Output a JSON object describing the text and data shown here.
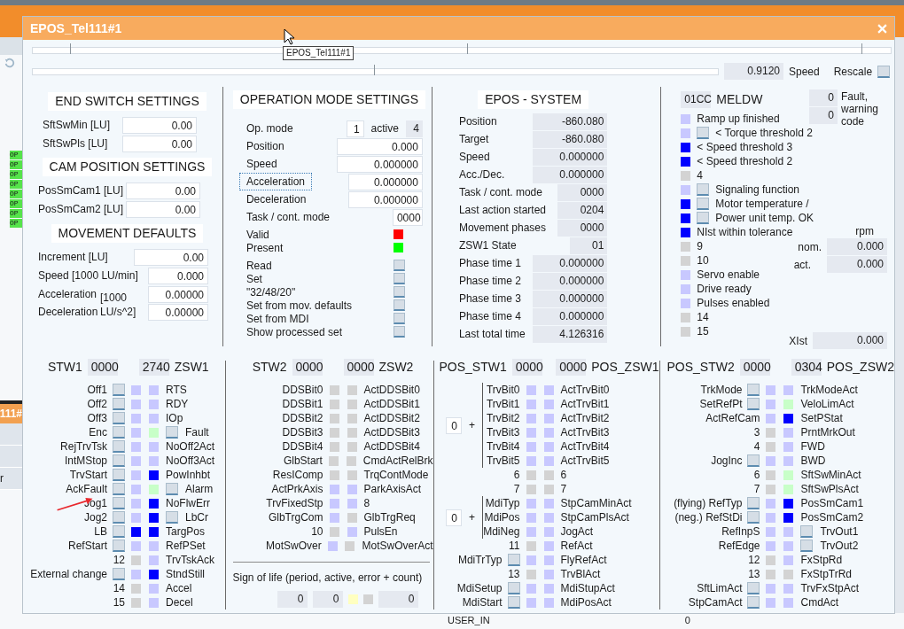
{
  "backdrop": {
    "tags": [
      "OP",
      "OP",
      "OP",
      "OP",
      "OP",
      "OP",
      "OP",
      "OP"
    ],
    "tab_fragment": "111#",
    "row_fragment": "r",
    "bottom_label": "USER_IN",
    "bottom_value": "0"
  },
  "window": {
    "title": "EPOS_Tel111#1",
    "tooltip": "EPOS_Tel111#1"
  },
  "speed": {
    "value": "0.9120",
    "label": "Speed",
    "rescale_label": "Rescale",
    "rescale_checked": false
  },
  "end_switch": {
    "title": "END SWITCH SETTINGS",
    "fields": [
      {
        "label": "SftSwMin [LU]",
        "value": "0.00"
      },
      {
        "label": "SftSwPls [LU]",
        "value": "0.00"
      }
    ]
  },
  "cam_position": {
    "title": "CAM POSITION SETTINGS",
    "fields": [
      {
        "label": "PosSmCam1 [LU]",
        "value": "0.00"
      },
      {
        "label": "PosSmCam2 [LU]",
        "value": "0.00"
      }
    ]
  },
  "movement": {
    "title": "MOVEMENT DEFAULTS",
    "fields": [
      {
        "label": "Increment [LU]",
        "value": "0.00"
      },
      {
        "label": "Speed [1000 LU/min]",
        "value": "0.000"
      }
    ],
    "accel_label": "Acceleration",
    "decel_label": "Deceleration",
    "unit": "[1000 LU/s^2]",
    "accel_value": "0.00000",
    "decel_value": "0.00000"
  },
  "op_mode": {
    "title": "OPERATION MODE SETTINGS",
    "mode_label": "Op. mode",
    "mode_value": "1",
    "active_label": "active",
    "active_value": "4",
    "fields": [
      {
        "label": "Position",
        "value": "0.000",
        "focused": false
      },
      {
        "label": "Speed",
        "value": "0.000000",
        "focused": false
      },
      {
        "label": "Acceleration",
        "value": "0.000000",
        "focused": true
      },
      {
        "label": "Deceleration",
        "value": "0.000000",
        "focused": false
      },
      {
        "label": "Task / cont. mode",
        "value": "0000",
        "focused": false
      }
    ],
    "indicators": [
      {
        "label": "Valid",
        "color": "#ff0000"
      },
      {
        "label": "Present",
        "color": "#00ff00"
      }
    ],
    "actions": [
      {
        "label": "Read",
        "checked": false
      },
      {
        "label": "Set",
        "checked": false
      },
      {
        "label": "\"32/48/20\"",
        "checked": false
      },
      {
        "label": "Set from mov. defaults",
        "checked": false
      },
      {
        "label": "Set from MDI",
        "checked": false
      },
      {
        "label": "Show processed set",
        "checked": false
      }
    ]
  },
  "epos_system": {
    "title": "EPOS - SYSTEM",
    "fields": [
      {
        "label": "Position",
        "value": "-860.080"
      },
      {
        "label": "Target",
        "value": "-860.080"
      },
      {
        "label": "Speed",
        "value": "0.000000"
      },
      {
        "label": "Acc./Dec.",
        "value": "0.000000"
      },
      {
        "label": "Task / cont. mode",
        "value": "0000"
      },
      {
        "label": "Last action started",
        "value": "0204"
      },
      {
        "label": "Movement phases",
        "value": "0000"
      },
      {
        "label": "ZSW1 State",
        "value": "01"
      },
      {
        "label": "Phase time 1",
        "value": "0.000000"
      },
      {
        "label": "Phase time 2",
        "value": "0.000000"
      },
      {
        "label": "Phase time 3",
        "value": "0.000000"
      },
      {
        "label": "Phase time 4",
        "value": "0.000000"
      },
      {
        "label": "Last total time",
        "value": "4.126316"
      }
    ]
  },
  "meldw": {
    "code": "01CC",
    "title": "MELDW",
    "fault_values": [
      "0",
      "0"
    ],
    "fault_label": "Fault, warning code",
    "rpm_label": "rpm",
    "nom_label": "nom.",
    "nom_value": "0.000",
    "act_label": "act.",
    "act_value": "0.000",
    "xist_label": "XIst",
    "xist_value": "0.000",
    "bits": [
      {
        "label": "Ramp up finished",
        "color": "#c8c8ff"
      },
      {
        "label": "< Torque threshold 2",
        "color": "#c8c8ff",
        "checked": false
      },
      {
        "label": "< Speed threshold 3",
        "color": "#0000ff"
      },
      {
        "label": "< Speed threshold 2",
        "color": "#0000ff"
      },
      {
        "label": "4",
        "color": "#d3d3d3"
      },
      {
        "label": "Signaling function",
        "color": "#c8c8ff",
        "checked": false
      },
      {
        "label": "Motor temperature /",
        "color": "#0000ff",
        "checked": false
      },
      {
        "label": "Power unit temp. OK",
        "color": "#0000ff",
        "checked": false
      },
      {
        "label": "NIst within tolerance",
        "color": "#0000ff"
      },
      {
        "label": "9",
        "color": "#d3d3d3"
      },
      {
        "label": "10",
        "color": "#d3d3d3"
      },
      {
        "label": "Servo enable",
        "color": "#c8c8ff"
      },
      {
        "label": "Drive ready",
        "color": "#c8c8ff"
      },
      {
        "label": "Pulses enabled",
        "color": "#c8c8ff"
      },
      {
        "label": "14",
        "color": "#d3d3d3"
      },
      {
        "label": "15",
        "color": "#d3d3d3"
      }
    ]
  },
  "stw1": {
    "left_label": "STW1",
    "left_value": "0000",
    "right_value": "2740",
    "right_label": "ZSW1",
    "rows": [
      {
        "in": {
          "label": "Off1",
          "checked": false,
          "color": "#c8c8ff"
        },
        "out": {
          "color": "#c8c8ff",
          "label": "RTS"
        }
      },
      {
        "in": {
          "label": "Off2",
          "checked": false,
          "color": "#c8c8ff"
        },
        "out": {
          "color": "#c8c8ff",
          "label": "RDY"
        }
      },
      {
        "in": {
          "label": "Off3",
          "checked": false,
          "color": "#c8c8ff"
        },
        "out": {
          "color": "#c8c8ff",
          "label": "IOp"
        }
      },
      {
        "in": {
          "label": "Enc",
          "checked": false,
          "color": "#c8c8ff"
        },
        "out": {
          "color": "#c8ffc8",
          "checked": false,
          "label": "Fault"
        }
      },
      {
        "in": {
          "label": "RejTrvTsk",
          "checked": false,
          "color": "#c8c8ff"
        },
        "out": {
          "color": "#c8c8ff",
          "label": "NoOff2Act"
        }
      },
      {
        "in": {
          "label": "IntMStop",
          "checked": false,
          "color": "#c8c8ff"
        },
        "out": {
          "color": "#c8c8ff",
          "label": "NoOff3Act"
        }
      },
      {
        "in": {
          "label": "TrvStart",
          "checked": false,
          "color": "#c8c8ff"
        },
        "out": {
          "color": "#0000ff",
          "label": "PowInhbt"
        }
      },
      {
        "in": {
          "label": "AckFault",
          "checked": false,
          "color": "#c8c8ff"
        },
        "out": {
          "color": "#c8ffc8",
          "checked": false,
          "label": "Alarm"
        }
      },
      {
        "in": {
          "label": "Jog1",
          "checked": false,
          "color": "#c8c8ff"
        },
        "out": {
          "color": "#0000ff",
          "label": "NoFlwErr"
        }
      },
      {
        "in": {
          "label": "Jog2",
          "checked": false,
          "color": "#c8c8ff"
        },
        "out": {
          "color": "#0000ff",
          "checked": false,
          "label": "LbCr"
        }
      },
      {
        "in": {
          "label": "LB",
          "checked": false,
          "color": "#0000ff"
        },
        "out": {
          "color": "#0000ff",
          "label": "TargPos"
        }
      },
      {
        "in": {
          "label": "RefStart",
          "checked": false,
          "color": "#c8c8ff"
        },
        "out": {
          "color": "#c8c8ff",
          "label": "RefPSet"
        }
      },
      {
        "in": {
          "label": "12",
          "color": "#d3d3d3"
        },
        "out": {
          "color": "#c8c8ff",
          "label": "TrvTskAck"
        }
      },
      {
        "in": {
          "label": "External change",
          "checked": false,
          "color": "#c8c8ff"
        },
        "out": {
          "color": "#0000ff",
          "label": "StndStill"
        }
      },
      {
        "in": {
          "label": "14",
          "color": "#d3d3d3"
        },
        "out": {
          "color": "#c8c8ff",
          "label": "Accel"
        }
      },
      {
        "in": {
          "label": "15",
          "color": "#d3d3d3"
        },
        "out": {
          "color": "#c8c8ff",
          "label": "Decel"
        }
      }
    ]
  },
  "stw2": {
    "left_label": "STW2",
    "left_value": "0000",
    "right_value": "0000",
    "right_label": "ZSW2",
    "rows": [
      {
        "in": {
          "label": "DDSBit0",
          "color": "#d3d3d3"
        },
        "out": {
          "color": "#d3d3d3",
          "label": "ActDDSBit0"
        }
      },
      {
        "in": {
          "label": "DDSBit1",
          "color": "#d3d3d3"
        },
        "out": {
          "color": "#d3d3d3",
          "label": "ActDDSBit1"
        }
      },
      {
        "in": {
          "label": "DDSBit2",
          "color": "#d3d3d3"
        },
        "out": {
          "color": "#d3d3d3",
          "label": "ActDDSBit2"
        }
      },
      {
        "in": {
          "label": "DDSBit3",
          "color": "#d3d3d3"
        },
        "out": {
          "color": "#d3d3d3",
          "label": "ActDDSBit3"
        }
      },
      {
        "in": {
          "label": "DDSBit4",
          "color": "#d3d3d3"
        },
        "out": {
          "color": "#d3d3d3",
          "label": "ActDDSBit4"
        }
      },
      {
        "in": {
          "label": "GlbStart",
          "color": "#d3d3d3"
        },
        "out": {
          "color": "#d3d3d3",
          "label": "CmdActRelBrk"
        }
      },
      {
        "in": {
          "label": "ResIComp",
          "color": "#d3d3d3"
        },
        "out": {
          "color": "#d3d3d3",
          "label": "TrqContMode"
        }
      },
      {
        "in": {
          "label": "ActPrkAxis",
          "color": "#c8c8ff"
        },
        "out": {
          "color": "#c8c8ff",
          "label": "ParkAxisAct"
        }
      },
      {
        "in": {
          "label": "TrvFixedStp",
          "color": "#c8c8ff"
        },
        "out": {
          "color": "#c8c8ff",
          "label": "8"
        }
      },
      {
        "in": {
          "label": "GlbTrgCom",
          "color": "#c8c8ff"
        },
        "out": {
          "color": "#d3d3d3",
          "label": "GlbTrgReq"
        }
      },
      {
        "in": {
          "label": "10",
          "color": "#d3d3d3"
        },
        "out": {
          "color": "#c8c8ff",
          "label": "PulsEn"
        }
      },
      {
        "in": {
          "label": "MotSwOver",
          "color": "#c8c8ff"
        },
        "out": {
          "color": "#d3d3d3",
          "label": "MotSwOverAct"
        }
      }
    ]
  },
  "sign_of_life": {
    "label": "Sign of life (period, active, error + count)",
    "period": "0",
    "active": "0",
    "indicators": [
      {
        "color": "#ffffc0"
      },
      {
        "color": "#d3d3d3"
      }
    ],
    "count": "0"
  },
  "pos_stw1": {
    "left_label": "POS_STW1",
    "left_value": "0000",
    "right_value": "0000",
    "right_label": "POS_ZSW1",
    "blocks": [
      {
        "kind": "group",
        "value": "0",
        "sign": "+",
        "rows": [
          {
            "in": {
              "label": "TrvBit0",
              "color": "#c8c8ff"
            },
            "out": {
              "color": "#c8c8ff",
              "label": "ActTrvBit0"
            }
          },
          {
            "in": {
              "label": "TrvBit1",
              "color": "#c8c8ff"
            },
            "out": {
              "color": "#c8c8ff",
              "label": "ActTrvBit1"
            }
          },
          {
            "in": {
              "label": "TrvBit2",
              "color": "#c8c8ff"
            },
            "out": {
              "color": "#c8c8ff",
              "label": "ActTrvBit2"
            }
          },
          {
            "in": {
              "label": "TrvBit3",
              "color": "#c8c8ff"
            },
            "out": {
              "color": "#c8c8ff",
              "label": "ActTrvBit3"
            }
          },
          {
            "in": {
              "label": "TrvBit4",
              "color": "#c8c8ff"
            },
            "out": {
              "color": "#c8c8ff",
              "label": "ActTrvBit4"
            }
          },
          {
            "in": {
              "label": "TrvBit5",
              "color": "#c8c8ff"
            },
            "out": {
              "color": "#c8c8ff",
              "label": "ActTrvBit5"
            }
          }
        ]
      },
      {
        "kind": "plain",
        "rows": [
          {
            "in": {
              "label": "6",
              "color": "#d3d3d3"
            },
            "out": {
              "color": "#d3d3d3",
              "label": "6"
            }
          },
          {
            "in": {
              "label": "7",
              "color": "#d3d3d3"
            },
            "out": {
              "color": "#d3d3d3",
              "label": "7"
            }
          }
        ]
      },
      {
        "kind": "group",
        "value": "0",
        "sign": "+",
        "rows": [
          {
            "in": {
              "label": "MdiTyp",
              "color": "#c8c8ff"
            },
            "out": {
              "color": "#c8c8ff",
              "label": "StpCamMinAct"
            }
          },
          {
            "in": {
              "label": "MdiPos",
              "color": "#c8c8ff"
            },
            "out": {
              "color": "#c8c8ff",
              "label": "StpCamPlsAct"
            }
          },
          {
            "in": {
              "label": "MdiNeg",
              "color": "#c8c8ff"
            },
            "out": {
              "color": "#c8c8ff",
              "label": "JogAct"
            }
          }
        ]
      },
      {
        "kind": "plain",
        "rows": [
          {
            "in": {
              "label": "11",
              "color": "#d3d3d3"
            },
            "out": {
              "color": "#c8c8ff",
              "label": "RefAct"
            }
          },
          {
            "in": {
              "label": "MdiTrTyp",
              "checked": false,
              "color": "#c8c8ff"
            },
            "out": {
              "color": "#c8c8ff",
              "label": "FlyRefAct"
            }
          },
          {
            "in": {
              "label": "13",
              "color": "#d3d3d3"
            },
            "out": {
              "color": "#c8c8ff",
              "label": "TrvBlAct"
            }
          },
          {
            "in": {
              "label": "MdiSetup",
              "checked": false,
              "color": "#c8c8ff"
            },
            "out": {
              "color": "#c8c8ff",
              "label": "MdiStupAct"
            }
          },
          {
            "in": {
              "label": "MdiStart",
              "checked": false,
              "color": "#c8c8ff"
            },
            "out": {
              "color": "#c8c8ff",
              "label": "MdiPosAct"
            }
          }
        ]
      }
    ]
  },
  "pos_stw2": {
    "left_label": "POS_STW2",
    "left_value": "0000",
    "right_value": "0304",
    "right_label": "POS_ZSW2",
    "rows": [
      {
        "in": {
          "label": "TrkMode",
          "checked": false,
          "color": "#c8c8ff"
        },
        "out": {
          "color": "#c8c8ff",
          "label": "TrkModeAct"
        }
      },
      {
        "in": {
          "label": "SetRefPt",
          "checked": false,
          "color": "#c8c8ff"
        },
        "out": {
          "color": "#c8ffc8",
          "label": "VeloLimAct"
        }
      },
      {
        "in": {
          "label": "ActRefCam",
          "color": "#c8c8ff"
        },
        "out": {
          "color": "#0000ff",
          "label": "SetPStat"
        }
      },
      {
        "in": {
          "label": "3",
          "color": "#d3d3d3"
        },
        "out": {
          "color": "#c8c8ff",
          "label": "PrntMrkOut"
        }
      },
      {
        "in": {
          "label": "4",
          "color": "#d3d3d3"
        },
        "out": {
          "color": "#c8c8ff",
          "label": "FWD"
        }
      },
      {
        "in": {
          "label": "JogInc",
          "checked": false,
          "color": "#c8c8ff"
        },
        "out": {
          "color": "#c8c8ff",
          "label": "BWD"
        }
      },
      {
        "in": {
          "label": "6",
          "color": "#d3d3d3"
        },
        "out": {
          "color": "#c8ffc8",
          "label": "SftSwMinAct"
        }
      },
      {
        "in": {
          "label": "7",
          "color": "#d3d3d3"
        },
        "out": {
          "color": "#c8ffc8",
          "label": "SftSwPlsAct"
        }
      },
      {
        "in": {
          "label": "(flying) RefTyp",
          "checked": false,
          "color": "#c8c8ff"
        },
        "out": {
          "color": "#0000ff",
          "label": "PosSmCam1"
        }
      },
      {
        "in": {
          "label": "(neg.) RefStDi",
          "checked": false,
          "color": "#c8c8ff"
        },
        "out": {
          "color": "#0000ff",
          "label": "PosSmCam2"
        }
      },
      {
        "in": {
          "label": "RefInpS",
          "color": "#c8c8ff"
        },
        "out": {
          "color": "#c8c8ff",
          "checked": false,
          "label": "TrvOut1"
        }
      },
      {
        "in": {
          "label": "RefEdge",
          "color": "#c8c8ff"
        },
        "out": {
          "color": "#c8c8ff",
          "checked": false,
          "label": "TrvOut2"
        }
      },
      {
        "in": {
          "label": "12",
          "color": "#d3d3d3"
        },
        "out": {
          "color": "#c8c8ff",
          "label": "FxStpRd"
        }
      },
      {
        "in": {
          "label": "13",
          "color": "#d3d3d3"
        },
        "out": {
          "color": "#d3d3d3",
          "label": "FxStpTrRd"
        }
      },
      {
        "in": {
          "label": "SftLimAct",
          "checked": false,
          "color": "#c8c8ff"
        },
        "out": {
          "color": "#c8c8ff",
          "label": "TrvFxStpAct"
        }
      },
      {
        "in": {
          "label": "StpCamAct",
          "checked": false,
          "color": "#c8c8ff"
        },
        "out": {
          "color": "#c8c8ff",
          "label": "CmdAct"
        }
      }
    ]
  }
}
